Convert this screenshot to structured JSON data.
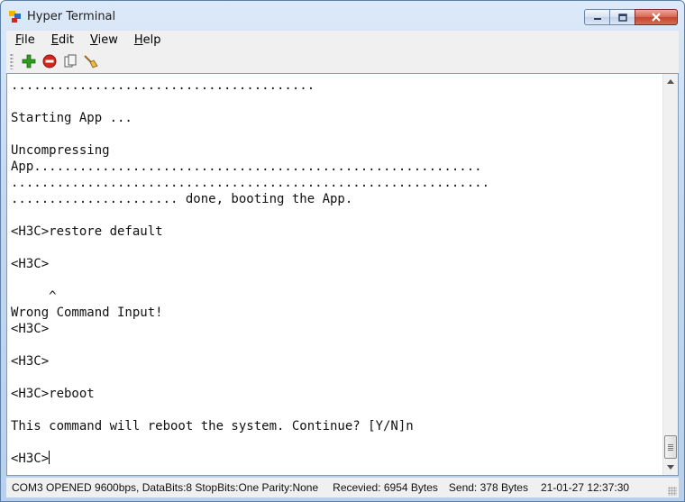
{
  "window": {
    "title": "Hyper Terminal"
  },
  "menu": {
    "items": [
      {
        "key": "F",
        "rest": "ile"
      },
      {
        "key": "E",
        "rest": "dit"
      },
      {
        "key": "V",
        "rest": "iew"
      },
      {
        "key": "H",
        "rest": "elp"
      }
    ]
  },
  "toolbar": {
    "icons": [
      "connect-icon",
      "disconnect-icon",
      "copy-icon",
      "clear-icon"
    ]
  },
  "terminal": {
    "lines": [
      "........................................",
      "",
      "Starting App ...",
      "",
      "Uncompressing",
      "App...........................................................",
      "...............................................................",
      "...................... done, booting the App.",
      "",
      "<H3C>restore default",
      "",
      "<H3C>",
      "",
      "     ^",
      "Wrong Command Input!",
      "<H3C>",
      "",
      "<H3C>",
      "",
      "<H3C>reboot",
      "",
      "This command will reboot the system. Continue? [Y/N]n",
      "",
      "<H3C>"
    ]
  },
  "status": {
    "connection": "COM3 OPENED 9600bps, DataBits:8 StopBits:One Parity:None",
    "received": "Recevied: 6954 Bytes",
    "sent": "Send: 378 Bytes",
    "time": "21-01-27 12:37:30"
  },
  "colors": {
    "titlebar": "#c4d8ef",
    "close_button": "#c4452c",
    "terminal_bg": "#ffffff",
    "add_icon": "#2e9b1e",
    "stop_icon": "#d4261c"
  }
}
